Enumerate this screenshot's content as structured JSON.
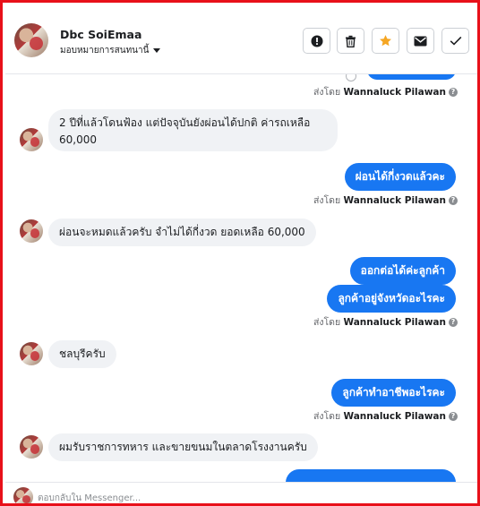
{
  "header": {
    "contact_name": "Dbc SoiEmaa",
    "assign_label": "มอบหมายการสนทนานี้"
  },
  "toolbar": {
    "icons": [
      "alert-icon",
      "trash-icon",
      "star-icon",
      "envelope-icon",
      "check-icon"
    ],
    "accent_star": "#f5a623"
  },
  "colors": {
    "outgoing": "#1877f2",
    "incoming": "#f0f2f5",
    "frame": "#e8101a"
  },
  "sent_by_prefix": "ส่งโดย",
  "sender_name": "Wannaluck Pilawan",
  "messages": [
    {
      "dir": "in",
      "text_line1": "2 ปีที่แล้วโดนฟ้อง แต่ปัจจุบันยังผ่อนได้ปกติ ค่ารถเหลือ",
      "text_line2": "60,000"
    },
    {
      "dir": "out",
      "text": "ผ่อนได้กี่งวดแล้วคะ"
    },
    {
      "dir": "in",
      "text": "ผ่อนจะหมดแล้วครับ จำไม่ได้กี่งวด ยอดเหลือ 60,000"
    },
    {
      "dir": "out",
      "text": "ออกต่อได้ค่ะลูกค้า"
    },
    {
      "dir": "out",
      "text": "ลูกค้าอยู่จังหวัดอะไรคะ"
    },
    {
      "dir": "in",
      "text": "ชลบุรีครับ"
    },
    {
      "dir": "out",
      "text": "ลูกค้าทำอาชีพอะไรคะ"
    },
    {
      "dir": "in",
      "text": "ผมรับราชการทหาร และขายขนมในตลาดโรงงานครับ"
    }
  ],
  "composer": {
    "placeholder": "ตอบกลับใน Messenger..."
  }
}
